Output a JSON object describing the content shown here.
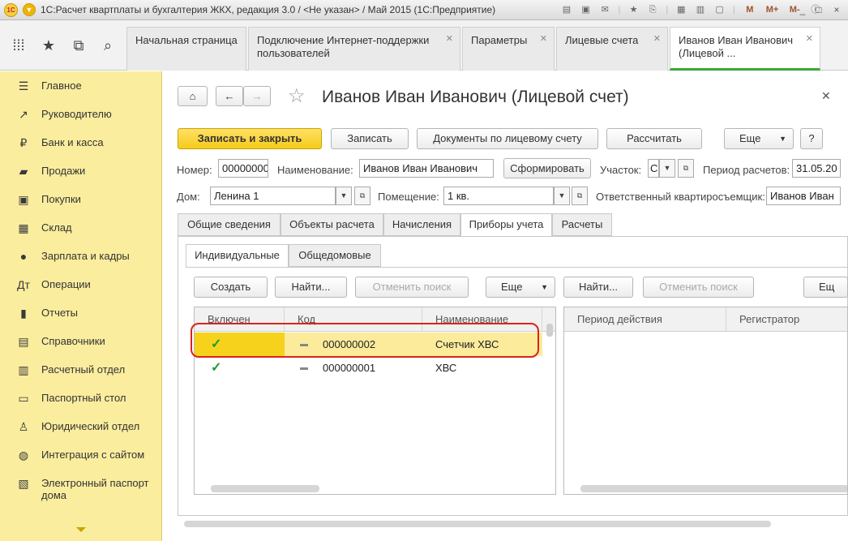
{
  "window": {
    "title": "1С:Расчет квартплаты и бухгалтерия ЖКХ, редакция 3.0 / <Не указан> / Май 2015  (1С:Предприятие)",
    "tools": [
      "M",
      "M+",
      "M-"
    ],
    "controls": [
      "_",
      "□",
      "×"
    ]
  },
  "tabs": [
    {
      "label": "Начальная страница"
    },
    {
      "label": "Подключение Интернет-поддержки пользователей"
    },
    {
      "label": "Параметры"
    },
    {
      "label": "Лицевые счета"
    },
    {
      "label": "Иванов Иван Иванович (Лицевой ..."
    }
  ],
  "sidebar": {
    "items": [
      {
        "label": "Главное",
        "icon": "list-icon"
      },
      {
        "label": "Руководителю",
        "icon": "trend-icon"
      },
      {
        "label": "Банк и касса",
        "icon": "bank-icon"
      },
      {
        "label": "Продажи",
        "icon": "cart-icon"
      },
      {
        "label": "Покупки",
        "icon": "purchase-icon"
      },
      {
        "label": "Склад",
        "icon": "warehouse-icon"
      },
      {
        "label": "Зарплата и кадры",
        "icon": "person-icon"
      },
      {
        "label": "Операции",
        "icon": "operations-icon"
      },
      {
        "label": "Отчеты",
        "icon": "chart-icon"
      },
      {
        "label": "Справочники",
        "icon": "book-icon"
      },
      {
        "label": "Расчетный отдел",
        "icon": "calc-icon"
      },
      {
        "label": "Паспортный стол",
        "icon": "passport-icon"
      },
      {
        "label": "Юридический отдел",
        "icon": "lawyer-icon"
      },
      {
        "label": "Интеграция с сайтом",
        "icon": "globe-icon"
      },
      {
        "label": "Электронный паспорт дома",
        "icon": "epassport-icon"
      }
    ]
  },
  "form": {
    "title": "Иванов Иван Иванович (Лицевой счет)",
    "buttons": {
      "save_close": "Записать и закрыть",
      "save": "Записать",
      "documents": "Документы по лицевому счету",
      "calculate": "Рассчитать",
      "more": "Еще",
      "help": "?",
      "generate": "Сформировать"
    },
    "fields": {
      "number_label": "Номер:",
      "number_value": "00000000",
      "name_label": "Наименование:",
      "name_value": "Иванов Иван Иванович",
      "area_label": "Участок:",
      "area_value": "С",
      "period_label": "Период расчетов:",
      "period_value": "31.05.20",
      "house_label": "Дом:",
      "house_value": "Ленина 1",
      "room_label": "Помещение:",
      "room_value": "1 кв.",
      "tenant_label": "Ответственный квартиросъемщик:",
      "tenant_value": "Иванов Иван"
    },
    "tabs": [
      "Общие сведения",
      "Объекты расчета",
      "Начисления",
      "Приборы учета",
      "Расчеты"
    ],
    "active_tab": "Приборы учета",
    "subtabs": [
      "Индивидуальные",
      "Общедомовые"
    ],
    "left_toolbar": {
      "create": "Создать",
      "find": "Найти...",
      "cancel_search": "Отменить поиск",
      "more": "Еще"
    },
    "right_toolbar": {
      "find": "Найти...",
      "cancel_search": "Отменить поиск",
      "more": "Ещ"
    },
    "meters_table": {
      "columns": [
        "Включен",
        "Код",
        "Наименование"
      ],
      "rows": [
        {
          "enabled": true,
          "code": "000000002",
          "name": "Счетчик ХВС",
          "selected": true
        },
        {
          "enabled": true,
          "code": "000000001",
          "name": "ХВС",
          "selected": false
        }
      ]
    },
    "periods_table": {
      "columns": [
        "Период действия",
        "Регистратор"
      ]
    }
  }
}
